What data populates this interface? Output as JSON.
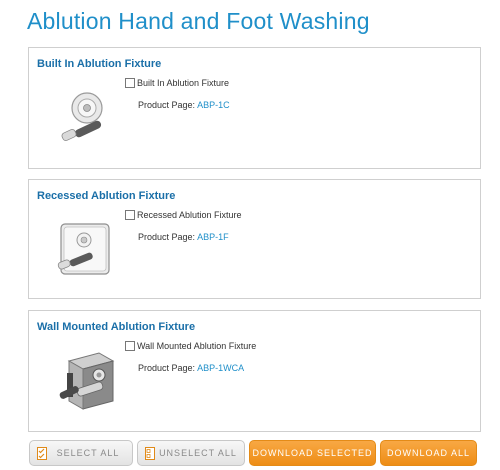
{
  "page": {
    "title": "Ablution Hand and Foot Washing"
  },
  "products": [
    {
      "title": "Built In Ablution Fixture",
      "checkbox_label": "Built In Ablution Fixture",
      "product_page_label": "Product Page:",
      "product_code": "ABP-1C",
      "image_icon": "built-in-fixture"
    },
    {
      "title": "Recessed Ablution Fixture",
      "checkbox_label": "Recessed Ablution Fixture",
      "product_page_label": "Product Page:",
      "product_code": "ABP-1F",
      "image_icon": "recessed-fixture"
    },
    {
      "title": "Wall Mounted Ablution Fixture",
      "checkbox_label": "Wall Mounted Ablution Fixture",
      "product_page_label": "Product Page:",
      "product_code": "ABP-1WCA",
      "image_icon": "wall-mounted-fixture"
    }
  ],
  "actions": {
    "select_all": "SELECT ALL",
    "unselect_all": "UNSELECT ALL",
    "download_selected": "DOWNLOAD SELECTED",
    "download_all": "DOWNLOAD ALL"
  },
  "colors": {
    "accent": "#1f8fc9",
    "card_title": "#1a6fa8",
    "orange": "#ee8d15"
  }
}
